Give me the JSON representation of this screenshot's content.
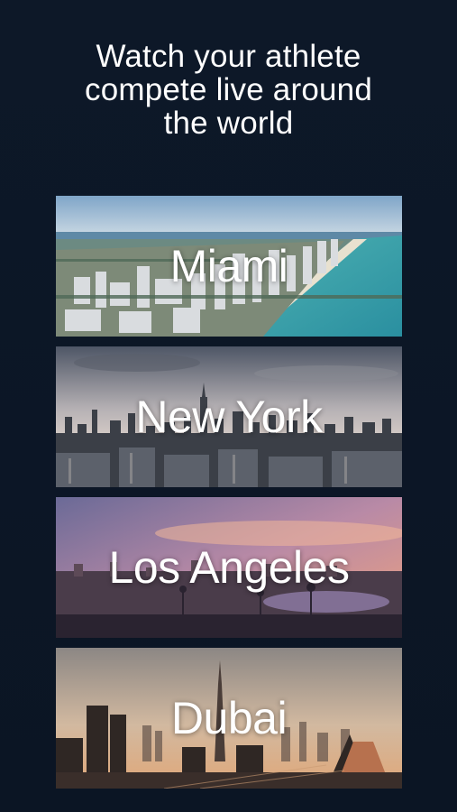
{
  "headline": {
    "line1": "Watch your athlete",
    "line2": "compete live around",
    "line3": "the world"
  },
  "cities": [
    {
      "name": "Miami"
    },
    {
      "name": "New York"
    },
    {
      "name": "Los Angeles"
    },
    {
      "name": "Dubai"
    }
  ],
  "colors": {
    "background": "#0c1626",
    "text": "#ffffff"
  }
}
